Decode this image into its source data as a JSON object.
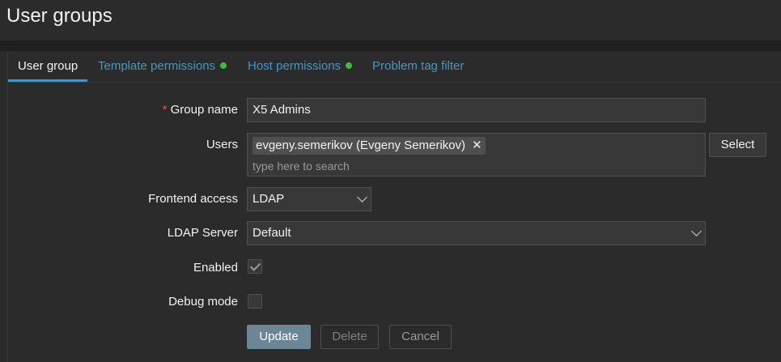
{
  "page": {
    "title": "User groups"
  },
  "tabs": [
    {
      "label": "User group",
      "active": true
    },
    {
      "label": "Template permissions",
      "status": "green"
    },
    {
      "label": "Host permissions",
      "status": "green"
    },
    {
      "label": "Problem tag filter"
    }
  ],
  "form": {
    "required_mark": "*",
    "group_name": {
      "label": "Group name",
      "value": "X5 Admins"
    },
    "users": {
      "label": "Users",
      "selected": [
        "evgeny.semerikov (Evgeny Semerikov)"
      ],
      "placeholder": "type here to search",
      "select_label": "Select"
    },
    "frontend_access": {
      "label": "Frontend access",
      "value": "LDAP"
    },
    "ldap_server": {
      "label": "LDAP Server",
      "value": "Default"
    },
    "enabled": {
      "label": "Enabled",
      "checked": true
    },
    "debug_mode": {
      "label": "Debug mode",
      "checked": false
    }
  },
  "actions": {
    "update": "Update",
    "delete": "Delete",
    "cancel": "Cancel"
  },
  "colors": {
    "accent": "#4796c4",
    "status_dot": "#3dbb3d",
    "required": "#e45959",
    "primary_button": "#6b8696"
  },
  "icons": {
    "remove_chip": "close-icon",
    "dropdown": "chevron-down-icon",
    "check": "checkmark-icon"
  }
}
